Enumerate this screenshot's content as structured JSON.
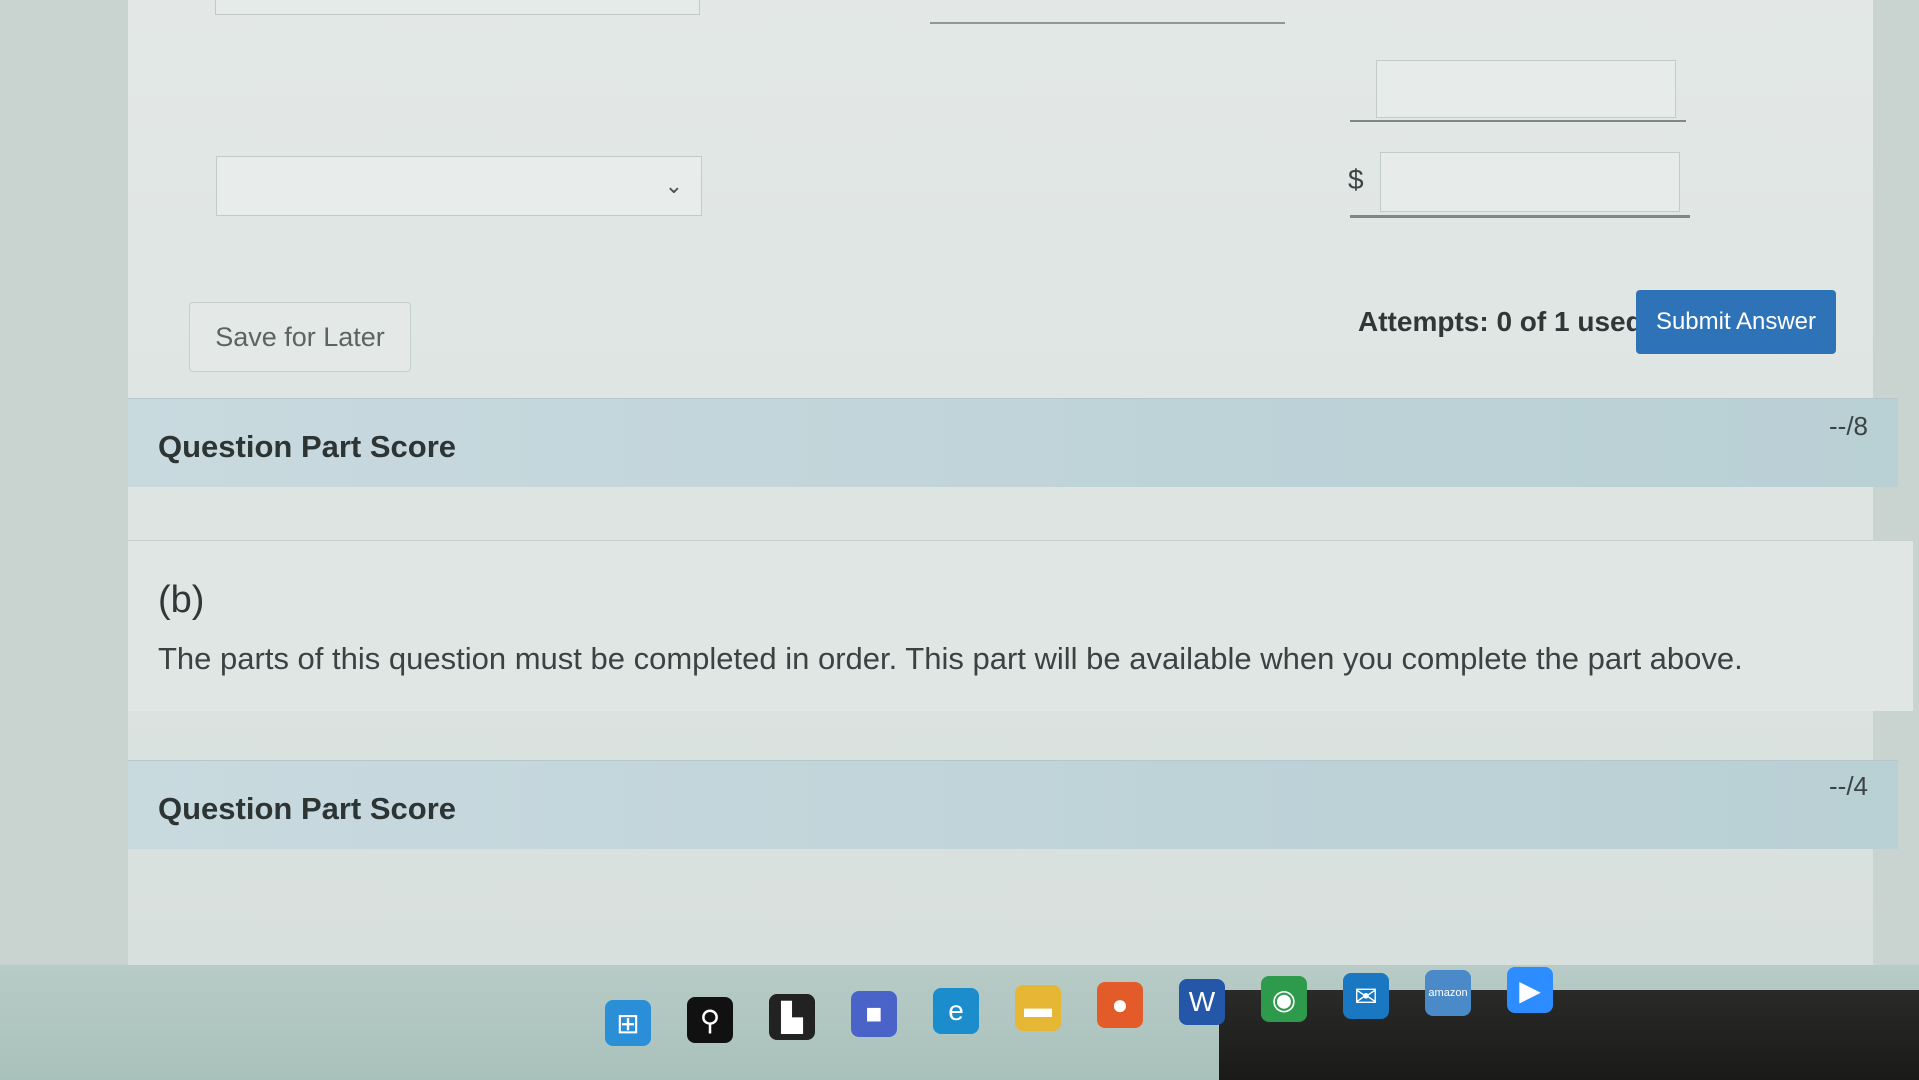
{
  "form": {
    "dollar_sign": "$",
    "select_chevron": "⌄",
    "save_label": "Save for Later",
    "attempts_text": "Attempts: 0 of 1 used",
    "submit_label": "Submit Answer"
  },
  "score_a": {
    "label": "Question Part Score",
    "value": "--/8"
  },
  "part_b": {
    "letter": "(b)",
    "message": "The parts of this question must be completed in order. This part will be available when you complete the part above."
  },
  "score_b": {
    "label": "Question Part Score",
    "value": "--/4"
  },
  "taskbar": {
    "icons": [
      {
        "name": "windows-start-icon",
        "glyph": "⊞",
        "color": "#2b8fd8"
      },
      {
        "name": "search-icon",
        "glyph": "⚲",
        "color": "#111111"
      },
      {
        "name": "task-view-icon",
        "glyph": "▙",
        "color": "#222222"
      },
      {
        "name": "chat-icon",
        "glyph": "■",
        "color": "#4a63c9"
      },
      {
        "name": "edge-icon",
        "glyph": "e",
        "color": "#1b8ccc"
      },
      {
        "name": "file-explorer-icon",
        "glyph": "▬",
        "color": "#e5b735"
      },
      {
        "name": "firefox-icon",
        "glyph": "●",
        "color": "#e45b2a"
      },
      {
        "name": "word-icon",
        "glyph": "W",
        "color": "#2457a8"
      },
      {
        "name": "chrome-icon",
        "glyph": "◉",
        "color": "#2d9a4c"
      },
      {
        "name": "mail-icon",
        "glyph": "✉",
        "color": "#1a78c2"
      },
      {
        "name": "amazon-icon",
        "glyph": "amazon",
        "color": "#4a8ac9"
      },
      {
        "name": "zoom-icon",
        "glyph": "▶",
        "color": "#2d8cff"
      }
    ]
  }
}
